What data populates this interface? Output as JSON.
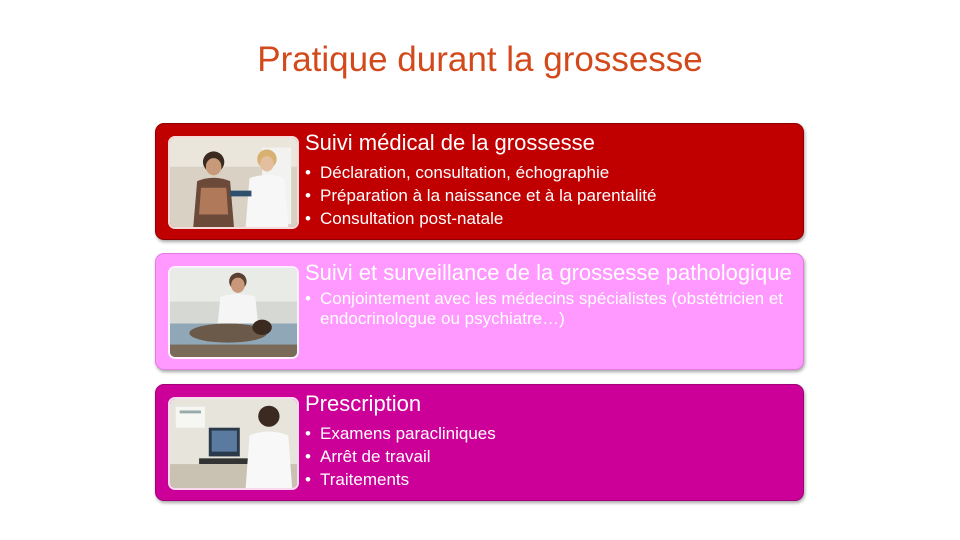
{
  "slide": {
    "title": "Pratique durant la grossesse"
  },
  "cards": [
    {
      "heading": "Suivi médical de la grossesse",
      "bullets": [
        "Déclaration, consultation, échographie",
        "Préparation à la naissance  et à la parentalité",
        "Consultation post-natale"
      ],
      "color": "#c00000"
    },
    {
      "heading": "Suivi et surveillance de la grossesse pathologique",
      "bullets": [
        "Conjointement avec les médecins spécialistes (obstétricien et endocrinologue ou psychiatre…)"
      ],
      "color": "#ff99ff"
    },
    {
      "heading": "Prescription",
      "bullets": [
        "Examens paracliniques",
        "Arrêt de travail",
        "Traitements"
      ],
      "color": "#cc0099"
    }
  ],
  "colors": {
    "title": "#d24a1c",
    "text": "#ffffff"
  }
}
